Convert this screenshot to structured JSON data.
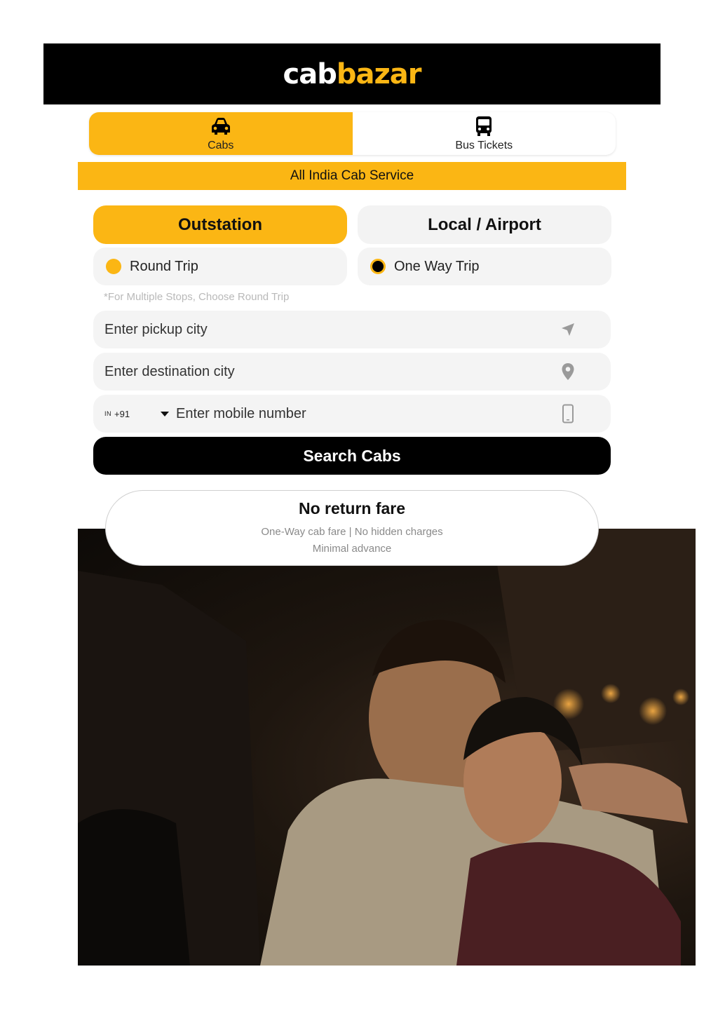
{
  "header": {
    "logo_part1": "cab",
    "logo_part2": "bazar"
  },
  "service_tabs": [
    {
      "label": "Cabs",
      "icon": "car-icon",
      "active": true
    },
    {
      "label": "Bus Tickets",
      "icon": "bus-icon",
      "active": false
    }
  ],
  "banner": "All India Cab Service",
  "modes": [
    {
      "label": "Outstation",
      "active": true
    },
    {
      "label": "Local / Airport",
      "active": false
    }
  ],
  "trip_types": [
    {
      "label": "Round Trip",
      "selected": false
    },
    {
      "label": "One Way Trip",
      "selected": true
    }
  ],
  "note": "*For Multiple Stops, Choose Round Trip",
  "fields": {
    "pickup": "Enter pickup city",
    "destination": "Enter destination city",
    "mobile": "Enter mobile number",
    "country_flag": "IN",
    "country_code": "+91"
  },
  "search_button": "Search Cabs",
  "fare_card": {
    "title": "No return fare",
    "line1": "One-Way cab fare | No hidden charges",
    "line2": "Minimal advance"
  },
  "colors": {
    "accent": "#fbb614",
    "header_bg": "#000000",
    "field_bg": "#f4f4f4"
  }
}
